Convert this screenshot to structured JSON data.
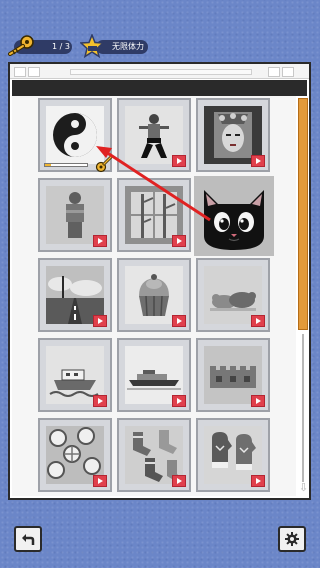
{
  "status_bar": {
    "keys": {
      "count_text": "1 / 3",
      "icon": "key-icon"
    },
    "stamina": {
      "label": "无限体力",
      "icon": "star-icon"
    }
  },
  "colors": {
    "background": "#6b86c8",
    "accent_orange": "#e39a3a",
    "play_red": "#e0404c",
    "arrow_red": "#e02222"
  },
  "gallery": {
    "tiles": [
      {
        "name": "yin-yang",
        "icon": "yin-yang-icon",
        "locked_video": false,
        "has_key": true,
        "progress": 0.15
      },
      {
        "name": "kung-fu-fighter",
        "icon": "fighter-icon",
        "locked_video": true
      },
      {
        "name": "opera-mask",
        "icon": "opera-mask-icon",
        "locked_video": true
      },
      {
        "name": "terracotta-warrior",
        "icon": "warrior-icon",
        "locked_video": true
      },
      {
        "name": "bamboo",
        "icon": "bamboo-icon",
        "locked_video": true
      },
      {
        "name": "black-cat",
        "icon": "cat-icon",
        "locked_video": true
      },
      {
        "name": "road",
        "icon": "road-icon",
        "locked_video": true
      },
      {
        "name": "cupcake",
        "icon": "cupcake-icon",
        "locked_video": true
      },
      {
        "name": "sleeping-cats",
        "icon": "cats-icon",
        "locked_video": true
      },
      {
        "name": "boat",
        "icon": "boat-icon",
        "locked_video": true
      },
      {
        "name": "ship",
        "icon": "ship-icon",
        "locked_video": true
      },
      {
        "name": "great-wall",
        "icon": "wall-icon",
        "locked_video": true
      },
      {
        "name": "citrus-pattern",
        "icon": "citrus-icon",
        "locked_video": true
      },
      {
        "name": "socks-pattern",
        "icon": "socks-icon",
        "locked_video": true
      },
      {
        "name": "mittens",
        "icon": "mittens-icon",
        "locked_video": true
      }
    ]
  },
  "toolbar": {
    "back_icon": "back-icon",
    "settings_icon": "gear-icon"
  }
}
